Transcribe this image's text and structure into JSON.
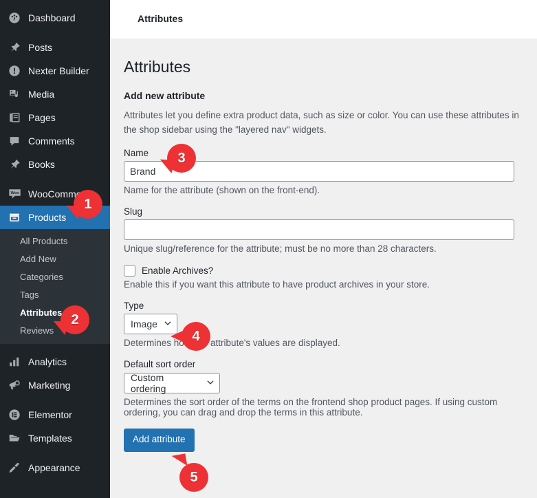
{
  "sidebar": {
    "items": [
      {
        "label": "Dashboard",
        "icon": "dashboard-icon",
        "key": "dashboard"
      },
      {
        "label": "Posts",
        "icon": "pin-icon",
        "key": "posts"
      },
      {
        "label": "Nexter Builder",
        "icon": "exclamation-circle-icon",
        "key": "nexter-builder"
      },
      {
        "label": "Media",
        "icon": "media-icon",
        "key": "media"
      },
      {
        "label": "Pages",
        "icon": "pages-icon",
        "key": "pages"
      },
      {
        "label": "Comments",
        "icon": "comment-icon",
        "key": "comments"
      },
      {
        "label": "Books",
        "icon": "pin-icon",
        "key": "books"
      },
      {
        "label": "WooCommerce",
        "icon": "woocommerce-icon",
        "key": "woocommerce"
      },
      {
        "label": "Products",
        "icon": "products-icon",
        "key": "products"
      }
    ],
    "submenu": [
      {
        "label": "All Products",
        "key": "all-products"
      },
      {
        "label": "Add New",
        "key": "add-new"
      },
      {
        "label": "Categories",
        "key": "categories"
      },
      {
        "label": "Tags",
        "key": "tags"
      },
      {
        "label": "Attributes",
        "key": "attributes"
      },
      {
        "label": "Reviews",
        "key": "reviews"
      }
    ],
    "items_after": [
      {
        "label": "Analytics",
        "icon": "bar-chart-icon",
        "key": "analytics"
      },
      {
        "label": "Marketing",
        "icon": "megaphone-icon",
        "key": "marketing"
      },
      {
        "label": "Elementor",
        "icon": "elementor-icon",
        "key": "elementor"
      },
      {
        "label": "Templates",
        "icon": "folder-icon",
        "key": "templates"
      },
      {
        "label": "Appearance",
        "icon": "brush-icon",
        "key": "appearance"
      }
    ]
  },
  "topbar": {
    "title": "Attributes"
  },
  "main": {
    "page_title": "Attributes",
    "section_heading": "Add new attribute",
    "intro": "Attributes let you define extra product data, such as size or color. You can use these attributes in the shop sidebar using the \"layered nav\" widgets.",
    "name_field": {
      "label": "Name",
      "value": "Brand",
      "placeholder": "",
      "description": "Name for the attribute (shown on the front-end)."
    },
    "slug_field": {
      "label": "Slug",
      "value": "",
      "placeholder": "",
      "description": "Unique slug/reference for the attribute; must be no more than 28 characters."
    },
    "enable_archives": {
      "label": "Enable Archives?",
      "checked": false,
      "description": "Enable this if you want this attribute to have product archives in your store."
    },
    "type_field": {
      "label": "Type",
      "value": "Image",
      "description": "Determines how this attribute's values are displayed."
    },
    "sort_field": {
      "label": "Default sort order",
      "value": "Custom ordering",
      "description": "Determines the sort order of the terms on the frontend shop product pages. If using custom ordering, you can drag and drop the terms in this attribute."
    },
    "submit_label": "Add attribute"
  },
  "callouts": [
    {
      "number": "1",
      "tail": "dl"
    },
    {
      "number": "2",
      "tail": "dl"
    },
    {
      "number": "3",
      "tail": "dl"
    },
    {
      "number": "4",
      "tail": "l"
    },
    {
      "number": "5",
      "tail": "ul"
    }
  ],
  "colors": {
    "sidebar_bg": "#1d2327",
    "submenu_bg": "#2c3338",
    "accent_blue": "#2271b1",
    "callout_red": "#ee3134",
    "content_bg": "#f0f0f1"
  }
}
